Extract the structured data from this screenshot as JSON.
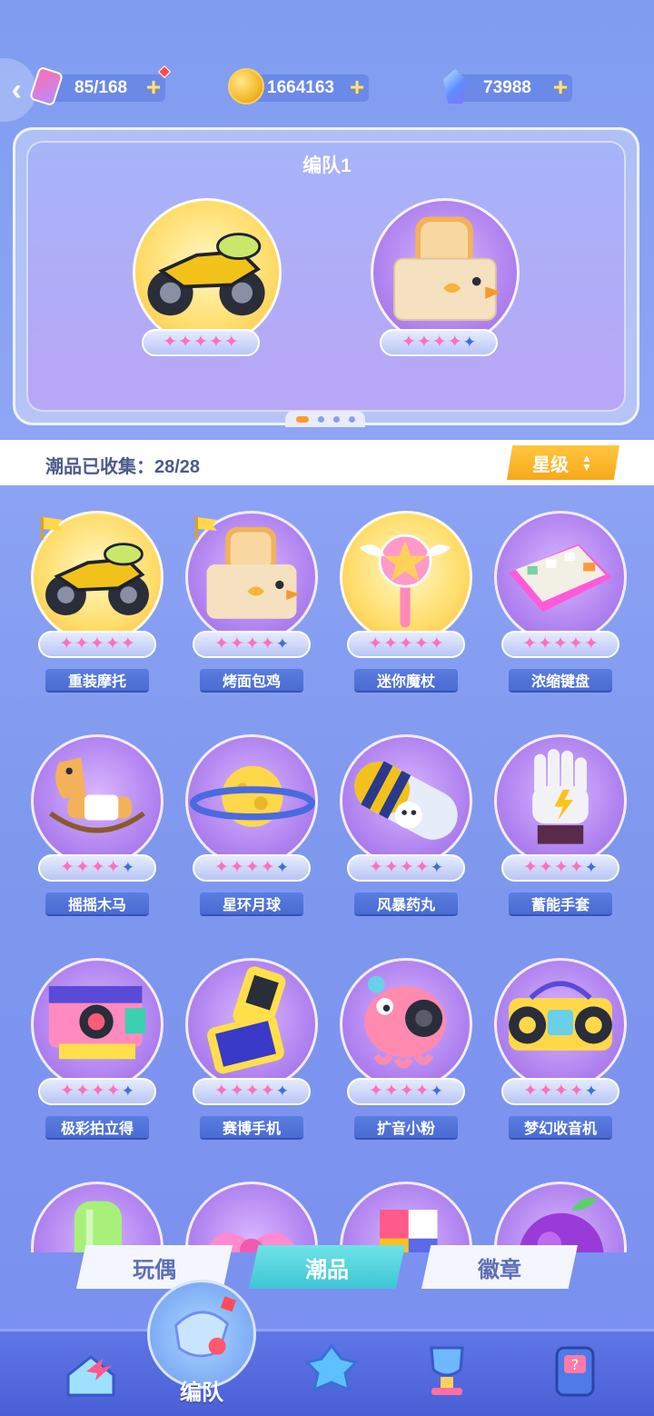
{
  "topbar": {
    "stamina": {
      "icon": "stamina-icon",
      "value": "85/168"
    },
    "coins": {
      "icon": "coin-icon",
      "value": "1664163"
    },
    "gems": {
      "icon": "gem-icon",
      "value": "73988"
    },
    "plus": "+"
  },
  "team": {
    "title": "编队1",
    "members": [
      {
        "name": "重装摩托",
        "icon": "motorcycle-icon",
        "stars": 5
      },
      {
        "name": "烤面包鸡",
        "icon": "toaster-chick-icon",
        "stars": 4
      }
    ],
    "page_count": 4,
    "active_page": 1
  },
  "collection": {
    "label": "潮品已收集：28/28",
    "sort_label": "星级"
  },
  "star_glyph": "✦",
  "items": [
    {
      "name": "重装摩托",
      "icon": "motorcycle-icon",
      "stars": 5,
      "flag": true,
      "bg": "gold"
    },
    {
      "name": "烤面包鸡",
      "icon": "toaster-chick-icon",
      "stars": 4,
      "flag": true,
      "bg": "purple"
    },
    {
      "name": "迷你魔杖",
      "icon": "magic-wand-icon",
      "stars": 5,
      "flag": false,
      "bg": "gold"
    },
    {
      "name": "浓缩键盘",
      "icon": "keyboard-icon",
      "stars": 5,
      "flag": false,
      "bg": "purple"
    },
    {
      "name": "摇摇木马",
      "icon": "rocking-horse-icon",
      "stars": 4,
      "flag": false,
      "bg": "purple"
    },
    {
      "name": "星环月球",
      "icon": "ringed-moon-icon",
      "stars": 4,
      "flag": false,
      "bg": "purple"
    },
    {
      "name": "风暴药丸",
      "icon": "storm-pill-icon",
      "stars": 4,
      "flag": false,
      "bg": "purple"
    },
    {
      "name": "蓄能手套",
      "icon": "power-glove-icon",
      "stars": 4,
      "flag": false,
      "bg": "purple"
    },
    {
      "name": "极彩拍立得",
      "icon": "instant-camera-icon",
      "stars": 4,
      "flag": false,
      "bg": "purple"
    },
    {
      "name": "赛博手机",
      "icon": "flip-phone-icon",
      "stars": 4,
      "flag": false,
      "bg": "purple"
    },
    {
      "name": "扩音小粉",
      "icon": "pink-speaker-icon",
      "stars": 4,
      "flag": false,
      "bg": "purple"
    },
    {
      "name": "梦幻收音机",
      "icon": "boombox-icon",
      "stars": 4,
      "flag": false,
      "bg": "purple"
    },
    {
      "name": "",
      "icon": "popsicle-icon",
      "stars": 0,
      "flag": false,
      "bg": "purple"
    },
    {
      "name": "",
      "icon": "pink-bow-icon",
      "stars": 0,
      "flag": false,
      "bg": "purple"
    },
    {
      "name": "",
      "icon": "color-cube-icon",
      "stars": 0,
      "flag": false,
      "bg": "purple"
    },
    {
      "name": "",
      "icon": "plum-icon",
      "stars": 0,
      "flag": false,
      "bg": "purple"
    }
  ],
  "category_tabs": [
    {
      "label": "玩偶",
      "active": false
    },
    {
      "label": "潮品",
      "active": true
    },
    {
      "label": "徽章",
      "active": false
    }
  ],
  "bottom_nav": {
    "active_label": "编队",
    "items": [
      {
        "icon": "home-arrow-icon"
      },
      {
        "icon": "formation-whistle-icon"
      },
      {
        "icon": "gamepad-icon"
      },
      {
        "icon": "trophy-icon"
      },
      {
        "icon": "mystery-box-icon"
      }
    ]
  },
  "colors": {
    "accent_gold": "#f7a81a",
    "star_pink": "#ff6fbf",
    "star_empty": "#3f6fd8",
    "tab_active": "#3fc5d6"
  }
}
